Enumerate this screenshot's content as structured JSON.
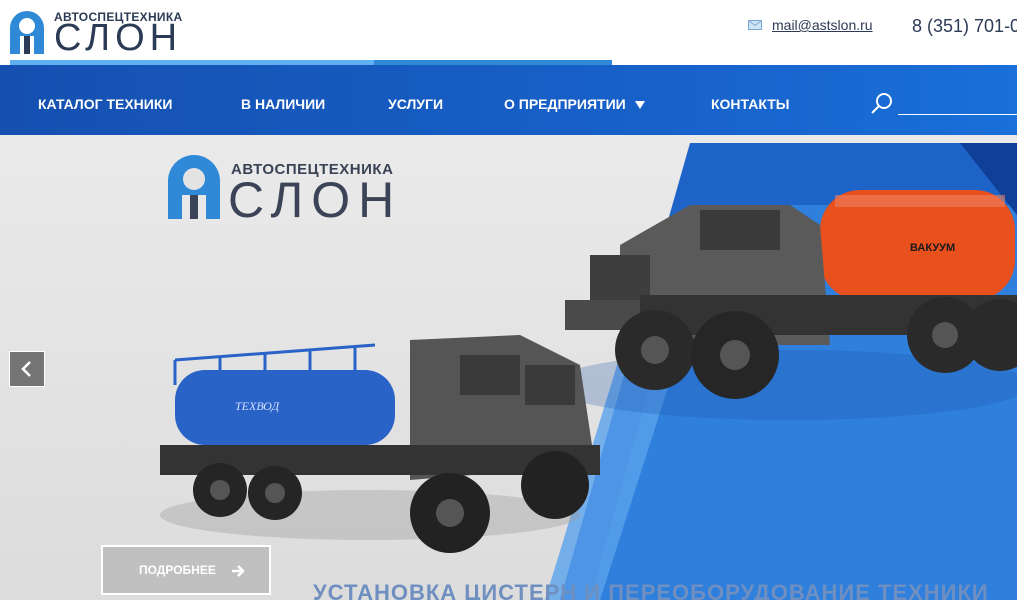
{
  "header": {
    "logo_sub": "АВТОСПЕЦТЕХНИКА",
    "logo_main": "СЛОН",
    "email": "mail@astslon.ru",
    "phone": "8 (351) 701-0"
  },
  "nav": {
    "items": [
      {
        "label": "КАТАЛОГ ТЕХНИКИ"
      },
      {
        "label": "В НАЛИЧИИ"
      },
      {
        "label": "УСЛУГИ"
      },
      {
        "label": "О ПРЕДПРИЯТИИ"
      },
      {
        "label": "КОНТАКТЫ"
      }
    ]
  },
  "hero": {
    "logo_sub": "АВТОСПЕЦТЕХНИКА",
    "logo_main": "СЛОН",
    "tank_label_1": "ТЕХВОД",
    "tank_label_2": "ВАКУУМ",
    "more_button": "ПОДРОБНЕЕ",
    "slogan": "УСТАНОВКА ЦИСТЕРН И ПЕРЕОБОРУДОВАНИЕ ТЕХНИКИ"
  },
  "colors": {
    "brand_dark": "#2b3a55",
    "nav_blue": "#1550b0",
    "accent_blue": "#2f89d7",
    "tank_orange": "#e8501e",
    "tank_blue": "#2a63c8"
  }
}
